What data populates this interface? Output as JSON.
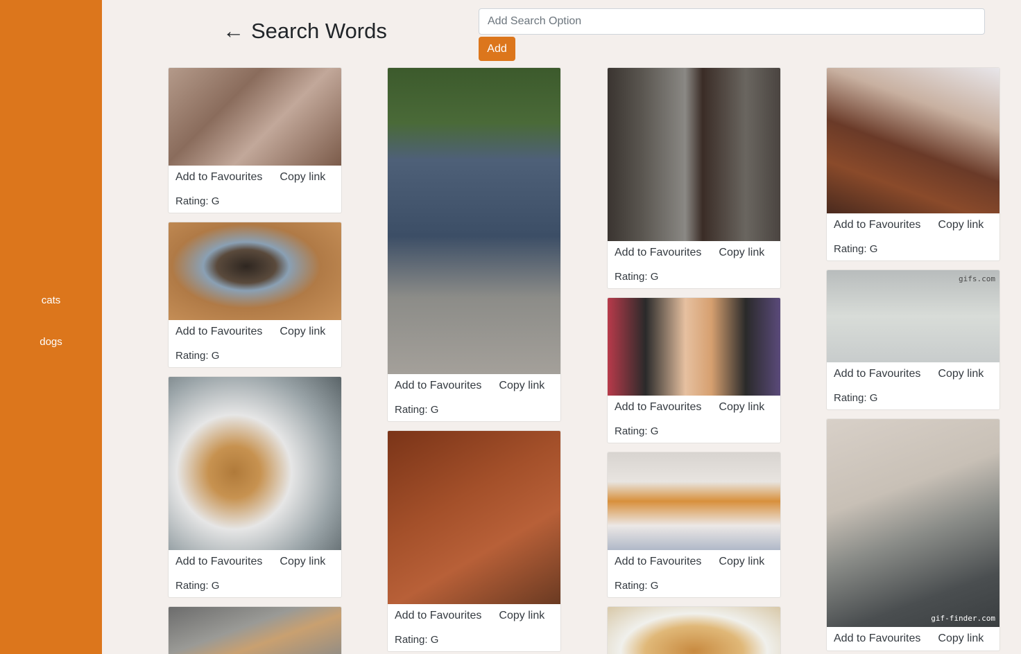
{
  "sidebar": {
    "items": [
      {
        "label": "cats"
      },
      {
        "label": "dogs"
      }
    ]
  },
  "header": {
    "arrow": "←",
    "title": "Search Words"
  },
  "search": {
    "placeholder": "Add Search Option",
    "add_label": "Add"
  },
  "card_labels": {
    "favourite": "Add to Favourites",
    "copy": "Copy link",
    "rating": "Rating: G"
  },
  "colors": {
    "accent": "#dc761c",
    "background": "#f4efec"
  },
  "gifs": [
    {
      "subject": "woman in armchair holding puppies"
    },
    {
      "subject": "puppies in pod dog bed"
    },
    {
      "subject": "golden retriever in snow"
    },
    {
      "subject": "shiba inu on street"
    },
    {
      "subject": "woman by blue car"
    },
    {
      "subject": "yoda toy with lightsaber and dogs"
    },
    {
      "subject": "dog jumping at window"
    },
    {
      "subject": "woman with cat puppets"
    },
    {
      "subject": "cats in bed"
    },
    {
      "subject": "cat with chef hat"
    },
    {
      "subject": "cat jumping on couch"
    },
    {
      "subject": "many cats on floor",
      "watermark": "gifs.com"
    },
    {
      "subject": "cat in doorway",
      "watermark": "gif-finder.com"
    }
  ]
}
